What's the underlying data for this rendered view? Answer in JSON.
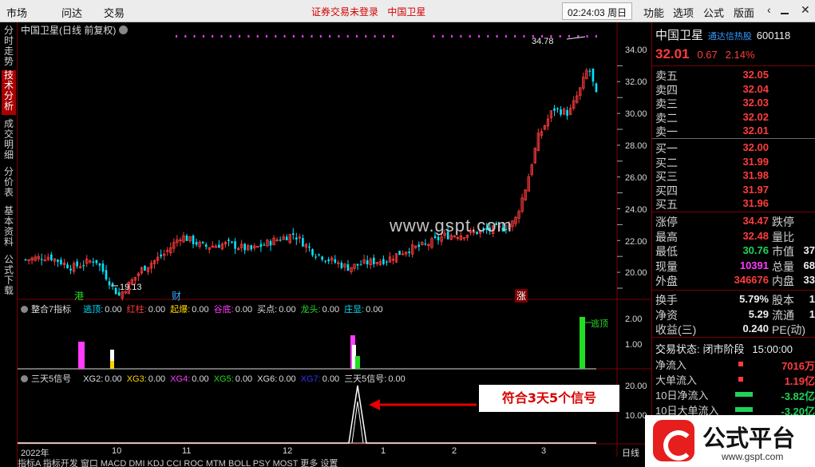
{
  "topbar": {
    "menu": [
      "市场",
      "问达",
      "交易"
    ],
    "login_status": "证券交易未登录",
    "stock_name": "中国卫星",
    "time": "02:24:03",
    "weekday": "周日",
    "right_menu": [
      "功能",
      "选项",
      "公式",
      "版面"
    ],
    "controls": [
      "chevron-left-icon",
      "minimize-icon",
      "maximize-icon",
      "close-icon"
    ]
  },
  "vtabs": [
    {
      "label": "分时走势",
      "active": false
    },
    {
      "label": "技术分析",
      "active": true
    },
    {
      "label": "成交明细",
      "active": false
    },
    {
      "label": "分价表",
      "active": false
    },
    {
      "label": "基本资料",
      "active": false
    },
    {
      "label": "公式下载",
      "active": false
    }
  ],
  "main_chart": {
    "title": "中国卫星(日线 前复权)",
    "high_label": "34.78",
    "low_label": "19.13",
    "markers": [
      "港",
      "财",
      "涨"
    ],
    "watermark": "www.gspt.com",
    "ylim": [
      19,
      35
    ]
  },
  "indicator1": {
    "name": "整合7指标",
    "fields": [
      {
        "label": "逃顶:",
        "value": "0.00",
        "color": "#00e0ff"
      },
      {
        "label": "红柱:",
        "value": "0.00",
        "color": "#ff3c3c"
      },
      {
        "label": "起爆:",
        "value": "0.00",
        "color": "#ffd200"
      },
      {
        "label": "谷底:",
        "value": "0.00",
        "color": "#ff3cff"
      },
      {
        "label": "买点:",
        "value": "0.00",
        "color": "#dddddd"
      },
      {
        "label": "龙头:",
        "value": "0.00",
        "color": "#22dd22"
      },
      {
        "label": "庄显:",
        "value": "0.00",
        "color": "#00e0ff"
      }
    ],
    "ticks": [
      "2.00",
      "1.00"
    ],
    "signal_label": "逃顶"
  },
  "indicator2": {
    "name": "三天5信号",
    "fields": [
      {
        "label": "XG2:",
        "value": "0.00",
        "color": "#dddddd"
      },
      {
        "label": "XG3:",
        "value": "0.00",
        "color": "#ffd200"
      },
      {
        "label": "XG4:",
        "value": "0.00",
        "color": "#ff3cff"
      },
      {
        "label": "XG5:",
        "value": "0.00",
        "color": "#22dd22"
      },
      {
        "label": "XG6:",
        "value": "0.00",
        "color": "#dddddd"
      },
      {
        "label": "XG7:",
        "value": "0.00",
        "color": "#3333ff"
      },
      {
        "label": "三天5信号:",
        "value": "0.00",
        "color": "#dddddd"
      }
    ],
    "ticks": [
      "20.00",
      "10.00"
    ],
    "annotation": "符合3天5个信号"
  },
  "time_axis": {
    "labels": [
      "2022年",
      "10",
      "11",
      "12",
      "1",
      "2",
      "3"
    ],
    "period": "日线"
  },
  "bottom_tabs": "指标A 指标开发 窗口 MACD DMI KDJ CCI ROC MTM BOLL PSY MOST 更多 设置",
  "quote": {
    "name": "中国卫星",
    "tag": "通达信热股",
    "code": "600118",
    "price": "32.01",
    "change": "0.67",
    "pct": "2.14%",
    "asks": [
      {
        "label": "卖五",
        "price": "32.05"
      },
      {
        "label": "卖四",
        "price": "32.04"
      },
      {
        "label": "卖三",
        "price": "32.03"
      },
      {
        "label": "卖二",
        "price": "32.02"
      },
      {
        "label": "卖一",
        "price": "32.01"
      }
    ],
    "bids": [
      {
        "label": "买一",
        "price": "32.00"
      },
      {
        "label": "买二",
        "price": "31.99"
      },
      {
        "label": "买三",
        "price": "31.98"
      },
      {
        "label": "买四",
        "price": "31.97"
      },
      {
        "label": "买五",
        "price": "31.96"
      }
    ],
    "stats": [
      {
        "label": "涨停",
        "value": "34.47",
        "cls": "red",
        "label2": "跌停"
      },
      {
        "label": "最高",
        "value": "32.48",
        "cls": "red",
        "label2": "量比"
      },
      {
        "label": "最低",
        "value": "30.76",
        "cls": "green",
        "label2": "市值",
        "value2": "37"
      },
      {
        "label": "现量",
        "value": "10391",
        "cls": "magenta",
        "label2": "总量",
        "value2": "68"
      },
      {
        "label": "外盘",
        "value": "346676",
        "cls": "red",
        "label2": "内盘",
        "value2": "33"
      }
    ],
    "stats2": [
      {
        "label": "换手",
        "value": "5.79%",
        "label2": "股本",
        "value2": "1"
      },
      {
        "label": "净资",
        "value": "5.29",
        "label2": "流通",
        "value2": "1"
      },
      {
        "label": "收益(三)",
        "value": "0.240",
        "label2": "PE(动)",
        "value2": ""
      }
    ],
    "trade_status_label": "交易状态:",
    "trade_status": "闭市阶段",
    "trade_time": "15:00:00",
    "flows": [
      {
        "label": "净流入",
        "value": "7016万",
        "cls": "red"
      },
      {
        "label": "大单流入",
        "value": "1.19亿",
        "cls": "red"
      },
      {
        "label": "10日净流入",
        "value": "-3.82亿",
        "cls": "green"
      },
      {
        "label": "10日大单流入",
        "value": "-3.20亿",
        "cls": "green"
      }
    ]
  },
  "logo": {
    "title": "公式平台",
    "site": "www.gspt.com"
  }
}
